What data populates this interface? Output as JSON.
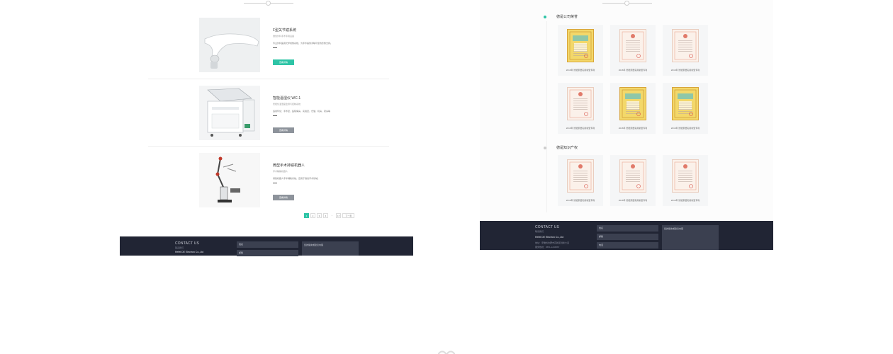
{
  "left": {
    "products": [
      {
        "title": "F型关节镜系统",
        "subtitle": "微创外科手术专用设备",
        "desc": "专业外科医用光学成像系统，为手术提供清晰可靠的影像支持。",
        "button": "查看详情",
        "button_style": "teal"
      },
      {
        "title": "智能温湿仪 WC-1",
        "subtitle": "智能化温湿度监测与控制系统",
        "desc": "适用环境：手术室、医院病房、实验室、仓储、机房、药房等",
        "button": "查看详情",
        "button_style": "gray"
      },
      {
        "title": "微型手术持镜机器人",
        "subtitle": "手术辅助机器人",
        "desc": "持镜机器人手术辅助系统，应用于微创手术领域。",
        "button": "查看详情",
        "button_style": "gray"
      }
    ],
    "pagination": [
      "1",
      "2",
      "3",
      "4",
      "…",
      "17",
      "下一页"
    ],
    "pagination_active": 0,
    "footer": {
      "title": "CONTACT US",
      "subtitle": "联系我们",
      "company": "Hefei DE Electron Co.,Ltd",
      "name_placeholder": "姓名",
      "phone_placeholder": "邮箱",
      "message_placeholder": "您的留言或建议内容"
    }
  },
  "right": {
    "sections": [
      {
        "title": "德是公司荣誉",
        "bullet_color": "#2ec4a6"
      },
      {
        "title": "德是知识产权",
        "bullet_color": "#cccccc"
      }
    ],
    "honor_certs": [
      {
        "caption": "2016年 智能家居实用新型专利",
        "style": "gold"
      },
      {
        "caption": "2016年 智能家居实用新型专利",
        "style": "pink"
      },
      {
        "caption": "2016年 智能家居实用新型专利",
        "style": "pink"
      },
      {
        "caption": "2016年 智能家居实用新型专利",
        "style": "pink"
      },
      {
        "caption": "2016年 智能家居实用新型专利",
        "style": "gold"
      },
      {
        "caption": "2016年 智能家居实用新型专利",
        "style": "gold"
      }
    ],
    "ip_certs": [
      {
        "caption": "2016年 智能家居实用新型专利",
        "style": "pink"
      },
      {
        "caption": "2016年 智能家居实用新型专利",
        "style": "pink"
      },
      {
        "caption": "2016年 智能家居实用新型专利",
        "style": "pink"
      }
    ],
    "footer": {
      "title": "CONTACT US",
      "subtitle": "联系我们",
      "company": "Hefei DE Electron Co.,Ltd",
      "address": "地址：安徽省合肥市高新区创新大道",
      "phone": "服务热线：0551-1234567",
      "name_placeholder": "姓名",
      "email_placeholder": "邮箱",
      "phone_placeholder": "电话",
      "message_placeholder": "您的留言或建议内容"
    }
  },
  "colors": {
    "accent": "#2ec4a6",
    "footer_bg": "#212534",
    "field_bg": "#3b4050",
    "cert_gold": "#f3d86a",
    "cert_pink": "#fbf1ea"
  }
}
